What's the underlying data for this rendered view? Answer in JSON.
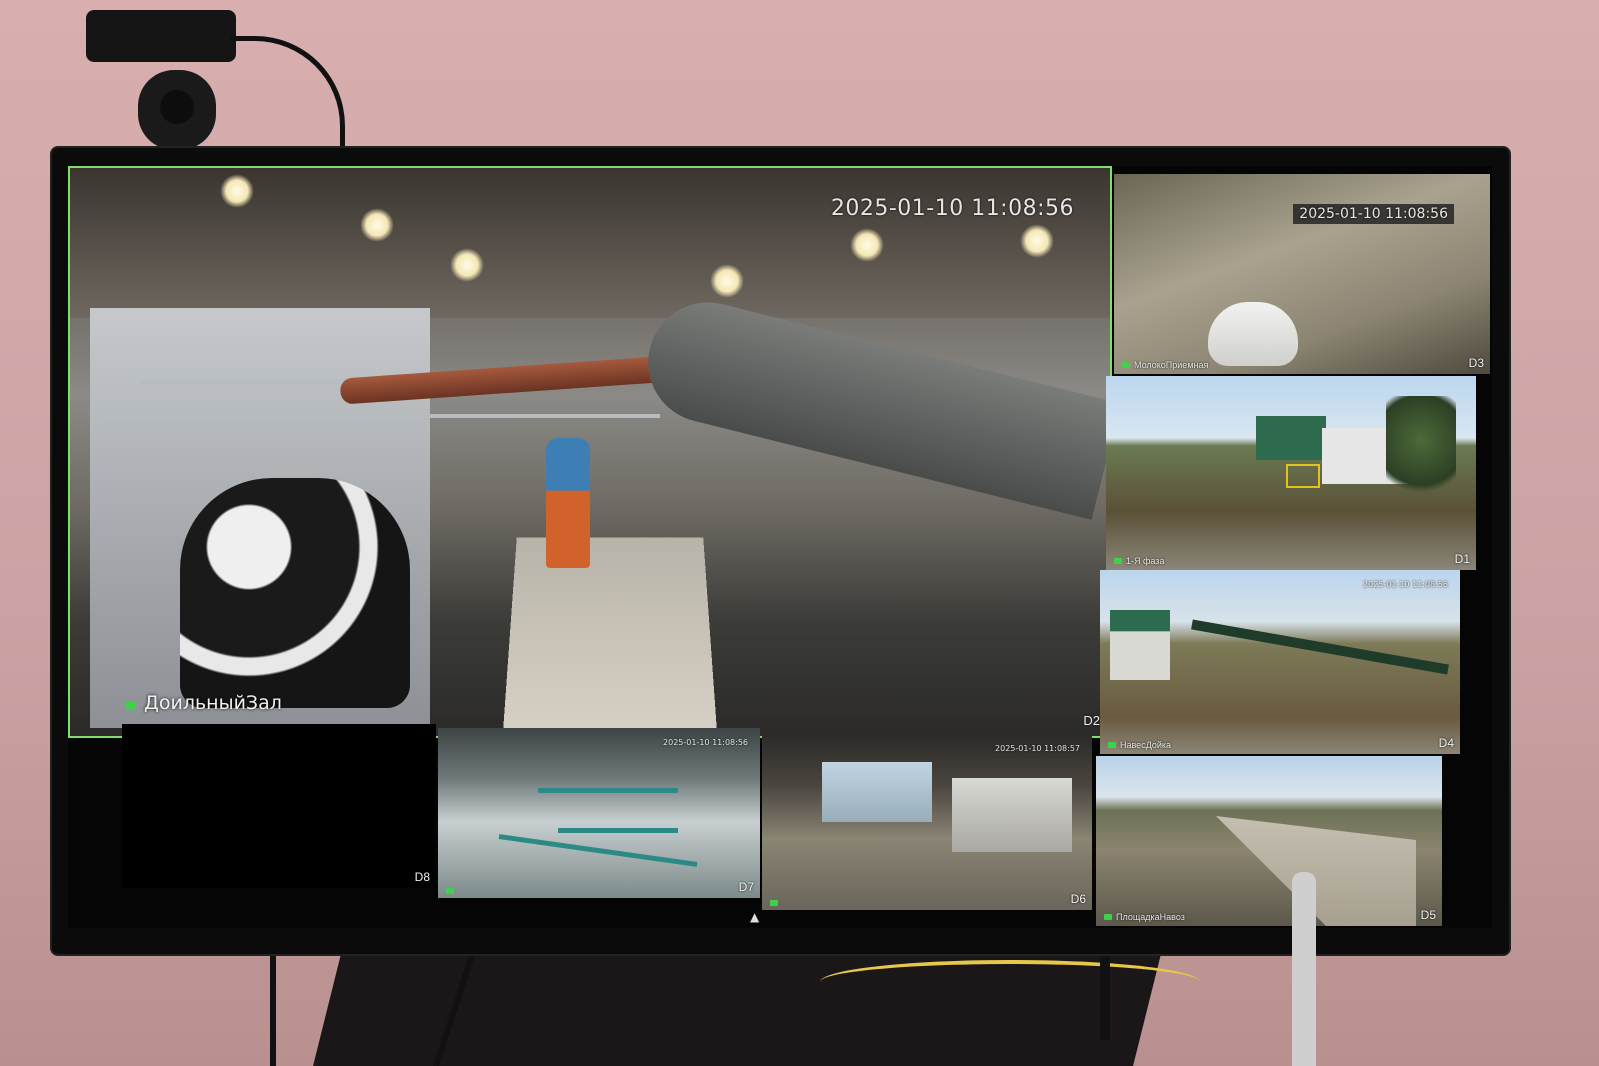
{
  "nvr": {
    "main_tile": {
      "channel": "D2",
      "camera_name": "ДоильныйЗал",
      "timestamp": "2025-01-10 11:08:56"
    },
    "tiles": [
      {
        "channel": "D3",
        "camera_name": "МолокоПриемная",
        "timestamp": "2025-01-10 11:08:56"
      },
      {
        "channel": "D1",
        "camera_name": "1-Я фаза",
        "timestamp": ""
      },
      {
        "channel": "D4",
        "camera_name": "НавесДойка",
        "timestamp": "2025-01-10 11:08:56"
      },
      {
        "channel": "D5",
        "camera_name": "ПлощадкаНавоз",
        "timestamp": ""
      },
      {
        "channel": "D8",
        "camera_name": "",
        "timestamp": ""
      },
      {
        "channel": "D7",
        "camera_name": "",
        "timestamp": "2025-01-10 11:08:56"
      },
      {
        "channel": "D6",
        "camera_name": "",
        "timestamp": "2025-01-10 11:08:57"
      }
    ],
    "colors": {
      "selected_border": "#7ee06b",
      "rec_indicator": "#3fd14a",
      "roi_box": "#e2c21c"
    }
  }
}
